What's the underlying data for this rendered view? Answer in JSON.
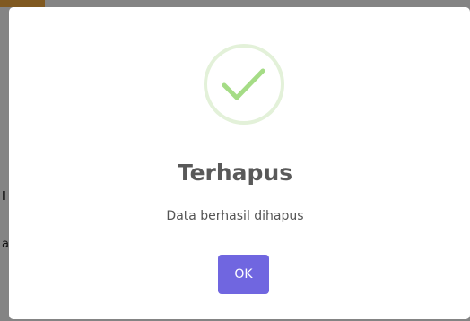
{
  "background": {
    "side_glyph_1": "I",
    "side_glyph_2": "a"
  },
  "alert": {
    "icon": "checkmark-icon",
    "title": "Terhapus",
    "text": "Data berhasil dihapus",
    "confirm_label": "OK"
  },
  "colors": {
    "success_ring": "#e3f1d9",
    "success_check": "#a5dc86",
    "confirm_button": "#7066e0",
    "accent": "#e9a23b"
  }
}
